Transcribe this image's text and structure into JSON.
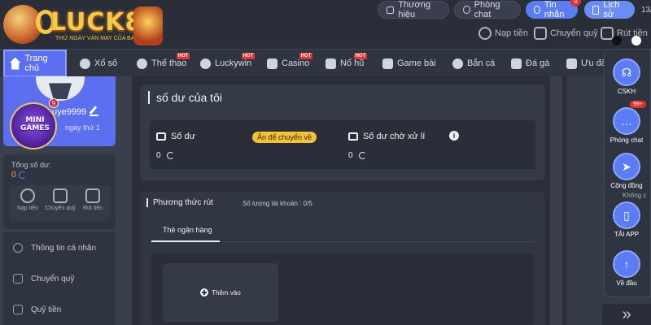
{
  "header": {
    "logo_text": "LUCK8",
    "logo_tagline": "THỨ NGÀY VÀN MAY CỦA BẠN",
    "buttons": [
      {
        "label": "Thương hiệu",
        "icon": "store-icon"
      },
      {
        "label": "Phòng chat",
        "icon": "chat-icon"
      },
      {
        "label": "Tin nhắn",
        "icon": "message-icon",
        "badge": "9"
      },
      {
        "label": "Lịch sử",
        "icon": "history-icon"
      }
    ],
    "date_cut": "13/",
    "quick_actions": [
      "Nạp tiền",
      "Chuyển quỹ",
      "Rút tiền"
    ]
  },
  "nav": {
    "items": [
      {
        "label": "Trang chủ",
        "active": true
      },
      {
        "label": "Xổ số"
      },
      {
        "label": "Thể thao",
        "hot": true
      },
      {
        "label": "Luckywin",
        "hot": true
      },
      {
        "label": "Casino",
        "hot": true
      },
      {
        "label": "Nổ hũ",
        "hot": true
      },
      {
        "label": "Game bài"
      },
      {
        "label": "Bắn cá"
      },
      {
        "label": "Đá gà"
      },
      {
        "label": "Ưu đãi"
      }
    ],
    "hot_label": "HOT"
  },
  "sidebar": {
    "username": "uye9999",
    "day_text": "ngày thứ 1",
    "mini_games_label": "MINI GAMES",
    "mini_games_badge": "9",
    "total_balance_label": "Tổng số dư:",
    "total_balance_value": "0",
    "actions": [
      "Nạp tiền",
      "Chuyển quỹ",
      "Rút tiền"
    ],
    "menu": [
      "Thông tin cá nhân",
      "Chuyển quỹ",
      "Quỹ tiền"
    ]
  },
  "main": {
    "balance_title": "số dư của tôi",
    "balance_label": "Số dư",
    "hide_transfer_label": "Ẩn để chuyển về",
    "balance_value": "0",
    "pending_label": "Số dư chờ xử lí",
    "pending_value": "0",
    "withdraw_method_title": "Phương thức rút",
    "account_count": "Số lượng tài khoản : 0/5",
    "bank_tab": "Thẻ ngân hàng",
    "add_label": "Thêm vào"
  },
  "float_panel": {
    "dot_colors": [
      "#111111",
      "#ffffff"
    ],
    "buttons": [
      {
        "label": "CSKH",
        "icon": "headset-icon"
      },
      {
        "label": "Phòng chat",
        "icon": "chat-bubble-icon",
        "badge": "99+"
      },
      {
        "label": "Cộng đồng",
        "icon": "send-icon"
      },
      {
        "label": "TẢI APP",
        "icon": "phone-icon"
      },
      {
        "label": "Về đầu",
        "icon": "arrow-up-icon"
      }
    ],
    "cut_text": "Không c",
    "collapse_glyph": "»"
  },
  "colors": {
    "accent": "#5b6ff0",
    "accent_blue": "#5b7cf2",
    "hot_red": "#e3352f",
    "gold": "#f2c23a",
    "bg": "#2a2e39"
  }
}
